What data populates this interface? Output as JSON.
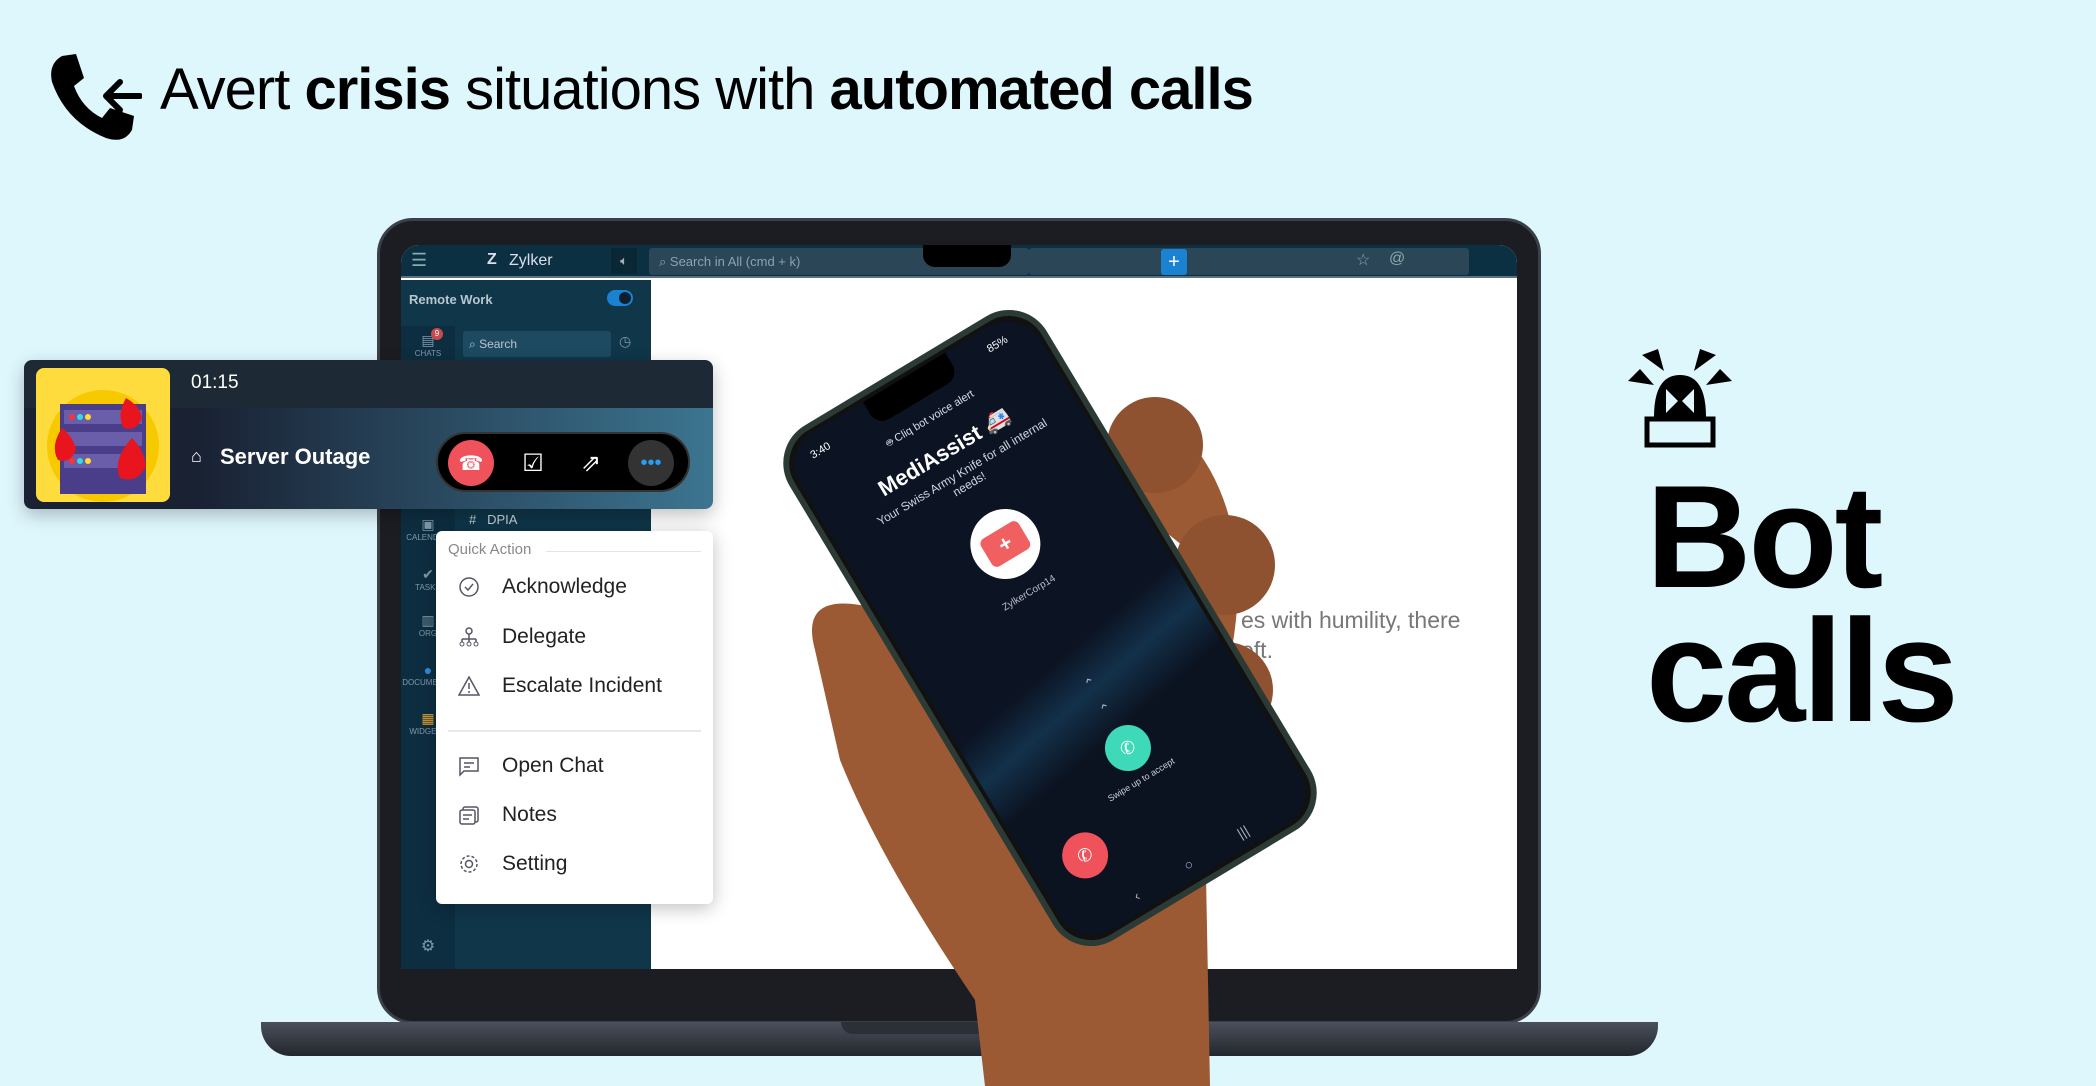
{
  "headline": {
    "part1": "Avert ",
    "bold1": "crisis",
    "part2": " situations with ",
    "bold2": "automated calls",
    "icon": "phone-incoming-icon"
  },
  "side_title": {
    "line1": "Bot",
    "line2": "calls",
    "icon": "siren-alarm-icon"
  },
  "app": {
    "brand": "Zylker",
    "search_placeholder": "Search in All (cmd + k)",
    "add_label": "+",
    "workspace": "Remote Work",
    "sidebar_search": "Search",
    "chats_badge": "9",
    "nav": [
      "CHATS",
      "CALENDAR",
      "TASKS",
      "ORG",
      "DOCUMENTS",
      "WIDGETS"
    ],
    "channel": "DPIA",
    "content_lines": [
      "es with humility, there",
      "eft."
    ]
  },
  "call_banner": {
    "timer": "01:15",
    "title": "Server Outage",
    "colors": {
      "end_call": "#f0525c",
      "avatar_bg": "#ffdc3d"
    }
  },
  "menu": {
    "heading": "Quick Action",
    "items": [
      {
        "label": "Acknowledge",
        "icon": "check-circle-icon"
      },
      {
        "label": "Delegate",
        "icon": "org-tree-icon"
      },
      {
        "label": "Escalate Incident",
        "icon": "warning-triangle-icon"
      },
      {
        "label": "Open Chat",
        "icon": "chat-icon"
      },
      {
        "label": "Notes",
        "icon": "notes-icon"
      },
      {
        "label": "Setting",
        "icon": "gear-icon"
      }
    ]
  },
  "phone": {
    "time": "3:40",
    "battery": "85%",
    "notice": "Cliq bot voice alert",
    "caller": "MediAssist 🚑",
    "tagline": "Your Swiss Army Knife for all internal needs!",
    "org": "ZylkerCorp14",
    "swipe_hint": "Swipe up to accept",
    "colors": {
      "accept": "#3dd9b8",
      "decline": "#f0525c"
    }
  }
}
